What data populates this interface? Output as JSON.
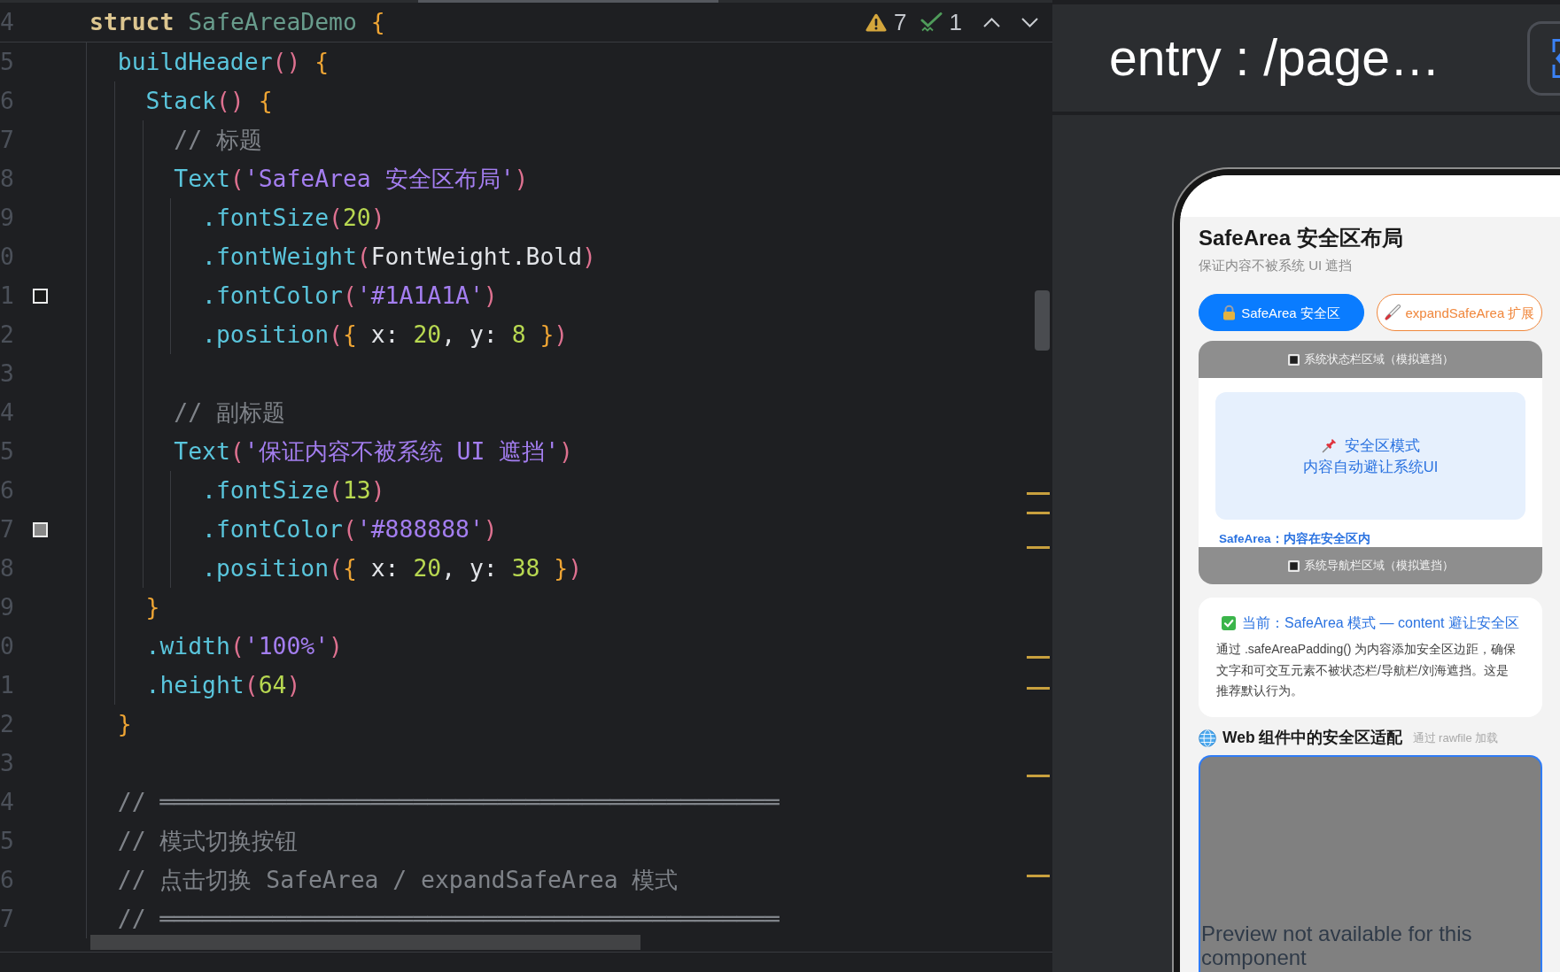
{
  "editor": {
    "toolbar": {
      "warnings": "7",
      "checks": "1"
    },
    "code": {
      "number": "4",
      "tokens": [
        {
          "kind": "keyword",
          "text": "struct "
        },
        {
          "kind": "type",
          "text": "SafeAreaDemo "
        },
        {
          "kind": "brace",
          "text": "{"
        }
      ],
      "children": [
        {
          "number": "5",
          "tokens": [
            {
              "kind": "fn",
              "text": "buildHeader"
            },
            {
              "kind": "paren",
              "text": "() "
            },
            {
              "kind": "brace",
              "text": "{"
            }
          ],
          "children": [
            {
              "number": "6",
              "tokens": [
                {
                  "kind": "fn",
                  "text": "Stack"
                },
                {
                  "kind": "paren",
                  "text": "() "
                },
                {
                  "kind": "brace",
                  "text": "{"
                }
              ],
              "children": [
                {
                  "number": "7",
                  "tokens": [
                    {
                      "kind": "comment",
                      "text": "// 标题"
                    }
                  ]
                },
                {
                  "number": "8",
                  "tokens": [
                    {
                      "kind": "fn",
                      "text": "Text"
                    },
                    {
                      "kind": "paren",
                      "text": "("
                    },
                    {
                      "kind": "string",
                      "text": "'SafeArea 安全区布局'"
                    },
                    {
                      "kind": "paren",
                      "text": ")"
                    }
                  ],
                  "children": [
                    {
                      "number": "9",
                      "tokens": [
                        {
                          "kind": "fn",
                          "text": ".fontSize"
                        },
                        {
                          "kind": "paren",
                          "text": "("
                        },
                        {
                          "kind": "number",
                          "text": "20"
                        },
                        {
                          "kind": "paren",
                          "text": ")"
                        }
                      ]
                    },
                    {
                      "number": "0",
                      "tokens": [
                        {
                          "kind": "fn",
                          "text": ".fontWeight"
                        },
                        {
                          "kind": "paren",
                          "text": "("
                        },
                        {
                          "kind": "plain",
                          "text": "FontWeight.Bold"
                        },
                        {
                          "kind": "paren",
                          "text": ")"
                        }
                      ]
                    },
                    {
                      "number": "1",
                      "swatch": {
                        "color": "#1a1a1a"
                      },
                      "tokens": [
                        {
                          "kind": "fn",
                          "text": ".fontColor"
                        },
                        {
                          "kind": "paren",
                          "text": "("
                        },
                        {
                          "kind": "string",
                          "text": "'#1A1A1A'"
                        },
                        {
                          "kind": "paren",
                          "text": ")"
                        }
                      ]
                    },
                    {
                      "number": "2",
                      "tokens": [
                        {
                          "kind": "fn",
                          "text": ".position"
                        },
                        {
                          "kind": "paren",
                          "text": "("
                        },
                        {
                          "kind": "brace",
                          "text": "{"
                        },
                        {
                          "kind": "plain",
                          "text": " x: "
                        },
                        {
                          "kind": "number",
                          "text": "20"
                        },
                        {
                          "kind": "plain",
                          "text": ", y: "
                        },
                        {
                          "kind": "number",
                          "text": "8"
                        },
                        {
                          "kind": "brace",
                          "text": " }"
                        },
                        {
                          "kind": "paren",
                          "text": ")"
                        }
                      ]
                    }
                  ]
                },
                {
                  "number": "3"
                },
                {
                  "number": "4",
                  "tokens": [
                    {
                      "kind": "comment",
                      "text": "// 副标题"
                    }
                  ]
                },
                {
                  "number": "5",
                  "tokens": [
                    {
                      "kind": "fn",
                      "text": "Text"
                    },
                    {
                      "kind": "paren",
                      "text": "("
                    },
                    {
                      "kind": "string",
                      "text": "'保证内容不被系统 UI 遮挡'"
                    },
                    {
                      "kind": "paren",
                      "text": ")"
                    }
                  ],
                  "children": [
                    {
                      "number": "6",
                      "tokens": [
                        {
                          "kind": "fn",
                          "text": ".fontSize"
                        },
                        {
                          "kind": "paren",
                          "text": "("
                        },
                        {
                          "kind": "number",
                          "text": "13"
                        },
                        {
                          "kind": "paren",
                          "text": ")"
                        }
                      ]
                    },
                    {
                      "number": "7",
                      "swatch": {
                        "color": "#888888"
                      },
                      "tokens": [
                        {
                          "kind": "fn",
                          "text": ".fontColor"
                        },
                        {
                          "kind": "paren",
                          "text": "("
                        },
                        {
                          "kind": "string",
                          "text": "'#888888'"
                        },
                        {
                          "kind": "paren",
                          "text": ")"
                        }
                      ]
                    },
                    {
                      "number": "8",
                      "tokens": [
                        {
                          "kind": "fn",
                          "text": ".position"
                        },
                        {
                          "kind": "paren",
                          "text": "("
                        },
                        {
                          "kind": "brace",
                          "text": "{"
                        },
                        {
                          "kind": "plain",
                          "text": " x: "
                        },
                        {
                          "kind": "number",
                          "text": "20"
                        },
                        {
                          "kind": "plain",
                          "text": ", y: "
                        },
                        {
                          "kind": "number",
                          "text": "38"
                        },
                        {
                          "kind": "brace",
                          "text": " }"
                        },
                        {
                          "kind": "paren",
                          "text": ")"
                        }
                      ]
                    }
                  ]
                }
              ]
            },
            {
              "number": "9",
              "tokens": [
                {
                  "kind": "brace",
                  "text": "}"
                }
              ]
            },
            {
              "number": "0",
              "tokens": [
                {
                  "kind": "fn",
                  "text": ".width"
                },
                {
                  "kind": "paren",
                  "text": "("
                },
                {
                  "kind": "string",
                  "text": "'100%'"
                },
                {
                  "kind": "paren",
                  "text": ")"
                }
              ]
            },
            {
              "number": "1",
              "tokens": [
                {
                  "kind": "fn",
                  "text": ".height"
                },
                {
                  "kind": "paren",
                  "text": "("
                },
                {
                  "kind": "number",
                  "text": "64"
                },
                {
                  "kind": "paren",
                  "text": ")"
                }
              ]
            }
          ]
        },
        {
          "number": "2",
          "tokens": [
            {
              "kind": "brace",
              "text": "}"
            }
          ]
        },
        {
          "number": "3"
        },
        {
          "number": "4",
          "tokens": [
            {
              "kind": "comment",
              "text": "// ════════════════════════════════════════════"
            }
          ]
        },
        {
          "number": "5",
          "tokens": [
            {
              "kind": "comment",
              "text": "// 模式切换按钮"
            }
          ]
        },
        {
          "number": "6",
          "tokens": [
            {
              "kind": "comment",
              "text": "// 点击切换 SafeArea / expandSafeArea 模式"
            }
          ]
        },
        {
          "number": "7",
          "tokens": [
            {
              "kind": "comment",
              "text": "// ════════════════════════════════════════════"
            }
          ]
        }
      ]
    }
  },
  "preview": {
    "title": "entry : /page…",
    "phone": {
      "title": "SafeArea 安全区布局",
      "subtitle": "保证内容不被系统 UI 遮挡",
      "mode_buttons": [
        {
          "label": "SafeArea 安全区",
          "selected": true,
          "color": "#0a7cff"
        },
        {
          "label": "expandSafeArea 扩展",
          "selected": false,
          "color": "#f0873c"
        }
      ],
      "demo": {
        "status_band": "系统状态栏区域（模拟遮挡）",
        "card_title": "安全区模式",
        "card_text": "内容自动避让系统UI",
        "caption": "SafeArea：内容在安全区内",
        "nav_band": "系统导航栏区域（模拟遮挡）"
      },
      "info": {
        "heading": "当前：SafeArea 模式 — content 避让安全区",
        "text": "通过 .safeAreaPadding() 为内容添加安全区边距，确保文字和可交互元素不被状态栏/导航栏/刘海遮挡。这是推荐默认行为。"
      },
      "web": {
        "title": "Web 组件中的安全区适配",
        "note": "通过 rawfile 加载",
        "message": "Preview not available for this component"
      }
    }
  }
}
